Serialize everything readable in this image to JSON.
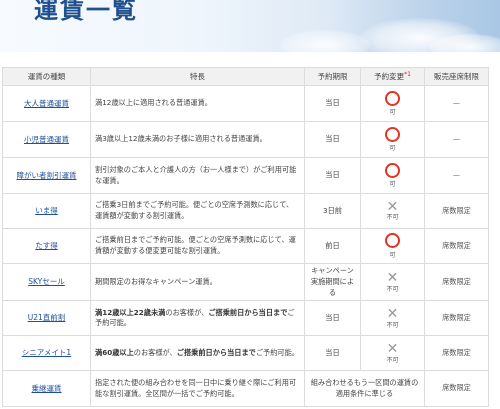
{
  "page": {
    "title": "運賃一覧"
  },
  "table": {
    "headers": {
      "name": "運賃の種類",
      "features": "特長",
      "period": "予約期限",
      "change": "予約変更",
      "change_mark": "*1",
      "limit": "販売座席制限"
    },
    "rows": [
      {
        "name": "大人普通運賃",
        "features": "満12歳以上に適用される普通運賃。",
        "period": "当日",
        "change_icon": "circle-icon",
        "change_text": "可",
        "limit": "—"
      },
      {
        "name": "小児普通運賃",
        "features": "満3歳以上12歳未満のお子様に適用される普通運賃。",
        "period": "当日",
        "change_icon": "circle-icon",
        "change_text": "可",
        "limit": "—"
      },
      {
        "name": "障がい者割引運賃",
        "features": "割引対象のご本人と介護人の方（お一人様まで）がご利用可能な運賃。",
        "period": "当日",
        "change_icon": "circle-icon",
        "change_text": "可",
        "limit": "—"
      },
      {
        "name": "いま得",
        "features": "ご搭乗3日前までご予約可能。便ごとの空席予測数に応じて、運賃額が変動する割引運賃。",
        "period": "3日前",
        "change_icon": "cross-icon",
        "change_text": "不可",
        "limit": "席数限定"
      },
      {
        "name": "たす得",
        "features": "ご搭乗前日までご予約可能。便ごとの空席予測数に応じて、運賃額が変動する便変更可能な割引運賃。",
        "period": "前日",
        "change_icon": "circle-icon",
        "change_text": "可",
        "limit": "席数限定"
      },
      {
        "name": "SKYセール",
        "features": "期間限定のお得なキャンペーン運賃。",
        "period": "キャンペーン実施期間による",
        "change_icon": "cross-icon",
        "change_text": "不可",
        "limit": "席数限定"
      },
      {
        "name": "U21直前割",
        "features_bold1": "満12歳以上22歳未満",
        "features_mid": "のお客様が、",
        "features_bold2": "ご搭乗前日から当日まで",
        "features_end": "ご予約可能。",
        "period": "当日",
        "change_icon": "cross-icon",
        "change_text": "不可",
        "limit": "席数限定"
      },
      {
        "name": "シニアメイト1",
        "features_bold1": "満60歳以上",
        "features_mid": "のお客様が、",
        "features_bold2": "ご搭乗前日から当日まで",
        "features_end": "ご予約可能。",
        "period": "当日",
        "change_icon": "cross-icon",
        "change_text": "不可",
        "limit": "席数限定"
      },
      {
        "name": "乗継運賃",
        "features": "指定された便の組み合わせを同一日中に乗り継ぐ際にご利用可能な割引運賃。全区間が一括でご予約可能。",
        "period": "組み合わせるもう一区間の運賃の適用条件に準じる",
        "limit": "席数限定"
      }
    ]
  },
  "colors": {
    "title": "#1f4f8c",
    "link": "#1d4f9c",
    "circle": "#e03424",
    "cross": "#9a9a9a"
  }
}
